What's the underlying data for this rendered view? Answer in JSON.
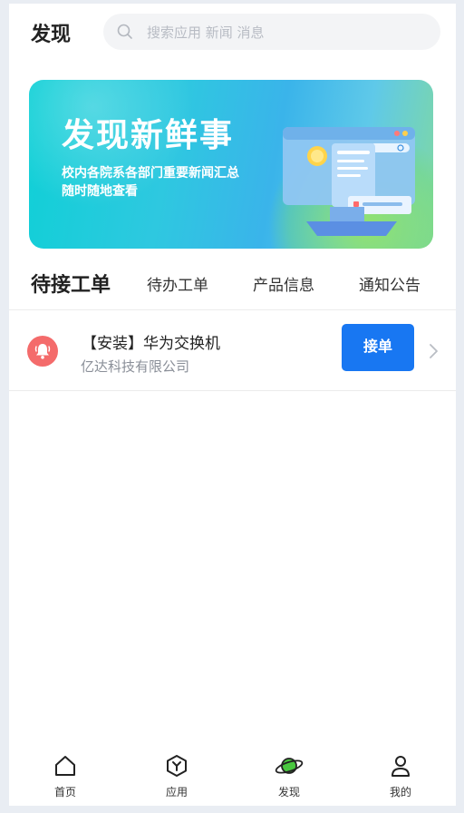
{
  "header": {
    "title": "发现",
    "search_placeholder": "搜索应用 新闻 消息"
  },
  "banner": {
    "title": "发现新鲜事",
    "line1": "校内各院系各部门重要新闻汇总",
    "line2": "随时随地查看"
  },
  "tabs": [
    {
      "label": "待接工单",
      "active": true
    },
    {
      "label": "待办工单",
      "active": false
    },
    {
      "label": "产品信息",
      "active": false
    },
    {
      "label": "通知公告",
      "active": false
    }
  ],
  "orders": [
    {
      "title": "【安装】华为交换机",
      "company": "亿达科技有限公司",
      "action": "接单",
      "icon": "bell-icon"
    }
  ],
  "bottom_nav": [
    {
      "label": "首页",
      "icon": "home-icon"
    },
    {
      "label": "应用",
      "icon": "apps-icon"
    },
    {
      "label": "发现",
      "icon": "planet-icon",
      "active": true
    },
    {
      "label": "我的",
      "icon": "user-icon"
    }
  ],
  "colors": {
    "accent": "#1877f2",
    "bell_bg": "#f46b6b",
    "planet_green": "#49c73f"
  }
}
